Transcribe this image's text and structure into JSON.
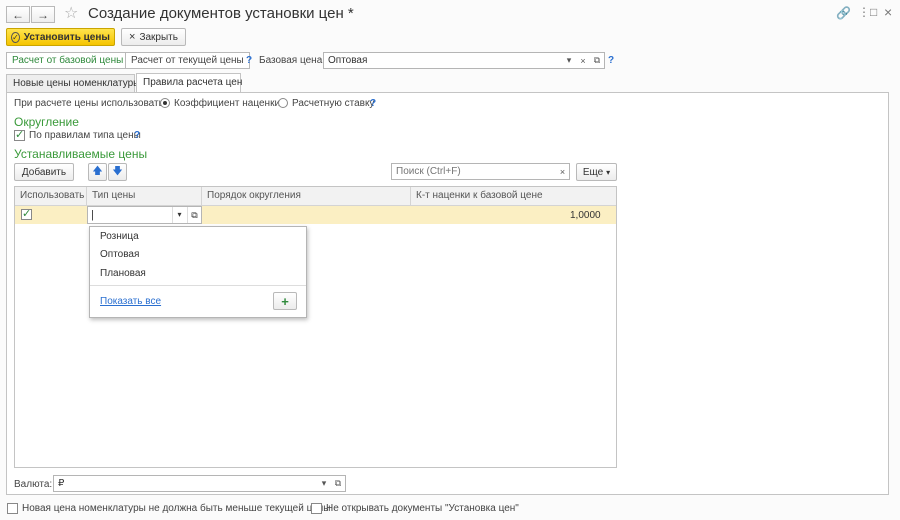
{
  "window": {
    "title": "Создание документов установки цен *",
    "nav_back": "←",
    "nav_forward": "→",
    "star": "☆",
    "link_icon": "🔗",
    "menu_icon": "⋮",
    "maximize_icon": "□",
    "close_icon": "×"
  },
  "toolbar": {
    "apply_label": "Установить цены",
    "apply_icon": "✓",
    "close_label": "Закрыть",
    "close_icon": "×"
  },
  "basis": {
    "from_base_label": "Расчет от базовой цены",
    "from_current_label": "Расчет от текущей цены",
    "help": "?",
    "base_price_label": "Базовая цена:",
    "base_price_value": "Оптовая",
    "help2": "?"
  },
  "tabs": [
    {
      "label": "Новые цены номенклатуры"
    },
    {
      "label": "Правила расчета цен"
    }
  ],
  "rules": {
    "use_label": "При расчете цены использовать:",
    "option_coeff": "Коэффициент наценки",
    "option_rate": "Расчетную ставку",
    "help": "?",
    "rounding_title": "Округление",
    "rounding_checkbox": "По правилам типа цены",
    "rounding_help": "?",
    "prices_title": "Устанавливаемые цены"
  },
  "grid_toolbar": {
    "add_label": "Добавить",
    "up_icon": "🡅",
    "down_icon": "🡇",
    "search_placeholder": "Поиск (Ctrl+F)",
    "search_clear": "×",
    "more_label": "Еще",
    "more_arrow": "▾"
  },
  "grid": {
    "columns": [
      "Использовать",
      "Тип цены",
      "Порядок округления",
      "К-т наценки к базовой цене"
    ],
    "rows": [
      {
        "use": "✓",
        "price_type": "",
        "rounding": "",
        "coeff": "1,0000"
      }
    ]
  },
  "dropdown": {
    "items": [
      "Розница",
      "Оптовая",
      "Плановая"
    ],
    "show_all": "Показать все",
    "add_icon": "+"
  },
  "currency": {
    "label": "Валюта:",
    "value": "₽"
  },
  "footer": {
    "check1": "Новая цена номенклатуры не должна быть меньше текущей цены",
    "check2": "Не открывать документы \"Установка цен\""
  },
  "colors": {
    "accent_yellow": "#f5c400",
    "green_text": "#3a9a3a",
    "link_blue": "#2a6fd0",
    "selected_row": "#fbefc3"
  }
}
